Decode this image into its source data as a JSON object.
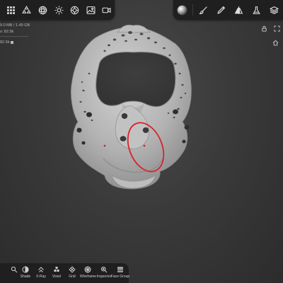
{
  "stats": {
    "memory": "9.0 MB / 1.49 GB",
    "faces": "s: 82.5k",
    "detail": "82.5k"
  },
  "top_left_tools": [
    "grid-icon",
    "shapes-icon",
    "sphere-icon",
    "sun-icon",
    "material-icon",
    "image-icon",
    "video-icon"
  ],
  "top_right_tools": [
    "matcap-icon",
    "brush-icon",
    "pencil-icon",
    "symmetry-icon",
    "flask-icon",
    "layers-icon"
  ],
  "bottom_bar": {
    "items": [
      {
        "label": "",
        "icon": "paint-icon"
      },
      {
        "label": "Shade",
        "icon": "shade-icon"
      },
      {
        "label": "X-Ray",
        "icon": "xray-icon"
      },
      {
        "label": "Voxel",
        "icon": "voxel-icon"
      },
      {
        "label": "Grid",
        "icon": "grid-icon"
      },
      {
        "label": "Wireframe",
        "icon": "wireframe-icon"
      },
      {
        "label": "Inspector",
        "icon": "inspector-icon"
      },
      {
        "label": "Face Group",
        "icon": "face-group-icon"
      }
    ]
  },
  "colors": {
    "toolbar_bg": "#1f1f1f",
    "viewport_bg": "#3a3a3a",
    "model": "#b5b5b5",
    "annotation": "#d8232a"
  }
}
